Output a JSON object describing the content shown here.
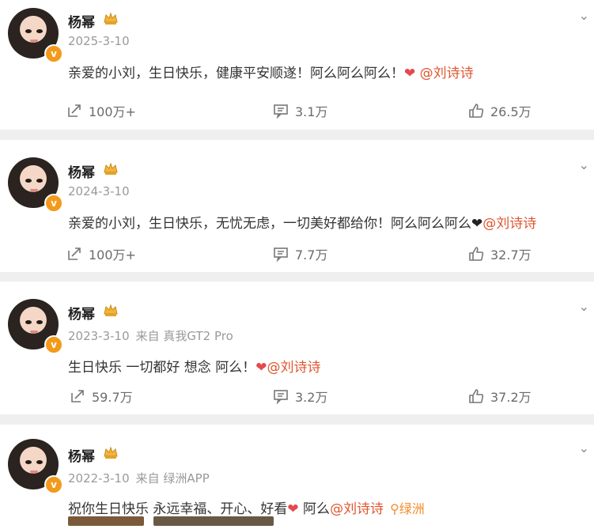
{
  "posts": [
    {
      "name": "杨幂",
      "date": "2025-3-10",
      "source": "",
      "text": "亲爱的小刘，生日快乐，健康平安顺遂！阿么阿么阿么！",
      "heart": "❤",
      "heart_color": "#e5484d",
      "mention": "@刘诗诗",
      "share": "100万+",
      "comment": "3.1万",
      "like": "26.5万"
    },
    {
      "name": "杨幂",
      "date": "2024-3-10",
      "source": "",
      "text": "亲爱的小刘，生日快乐，无忧无虑，一切美好都给你！阿么阿么阿么",
      "heart": "❤",
      "heart_color": "#222222",
      "mention": "@刘诗诗",
      "share": "100万+",
      "comment": "7.7万",
      "like": "32.7万"
    },
    {
      "name": "杨幂",
      "date": "2023-3-10",
      "source": "来自 真我GT2 Pro",
      "text": "生日快乐 一切都好 想念 阿么！",
      "heart": "❤",
      "heart_color": "#e5484d",
      "mention": "@刘诗诗",
      "share": "59.7万",
      "comment": "3.2万",
      "like": "37.2万"
    },
    {
      "name": "杨幂",
      "date": "2022-3-10",
      "source": "来自 绿洲APP",
      "text": "祝你生日快乐 永远幸福、开心、好看",
      "heart": "❤",
      "heart_color": "#e5484d",
      "text_after": " 阿么",
      "mention": "@刘诗诗",
      "oasis": "绿洲"
    }
  ],
  "icons": {
    "verified_badge": "v",
    "chevron": "chevron-down-icon",
    "crown": "crown-icon",
    "share": "share-icon",
    "comment": "comment-icon",
    "like": "thumbs-up-icon"
  },
  "colors": {
    "mention": "#e0552f",
    "badge": "#f39a1b",
    "oasis": "#f28e2b"
  }
}
